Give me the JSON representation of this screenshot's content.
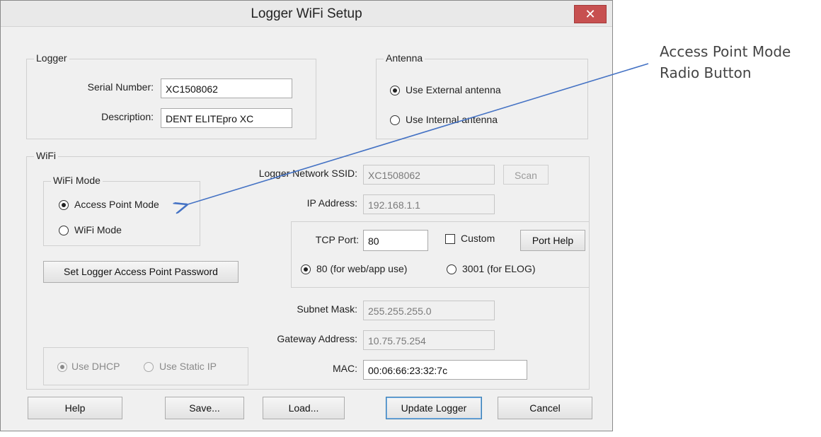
{
  "window": {
    "title": "Logger WiFi Setup",
    "close_glyph": "✕"
  },
  "logger": {
    "group_label": "Logger",
    "serial_label": "Serial Number:",
    "serial_value": "XC1508062",
    "desc_label": "Description:",
    "desc_value": "DENT ELITEpro XC"
  },
  "antenna": {
    "group_label": "Antenna",
    "external_label": "Use External antenna",
    "internal_label": "Use Internal antenna",
    "selected": "external"
  },
  "wifi": {
    "group_label": "WiFi",
    "mode_group_label": "WiFi Mode",
    "ap_mode_label": "Access Point Mode",
    "wifi_mode_label": "WiFi Mode",
    "selected_mode": "access-point",
    "set_password_label": "Set Logger Access Point Password",
    "ssid_label": "Logger Network SSID:",
    "ssid_value": "XC1508062",
    "scan_label": "Scan",
    "ip_label": "IP Address:",
    "ip_value": "192.168.1.1",
    "tcp_port_label": "TCP Port:",
    "tcp_port_value": "80",
    "custom_label": "Custom",
    "port_help_label": "Port Help",
    "port80_label": "80 (for web/app use)",
    "port3001_label": "3001 (for ELOG)",
    "subnet_label": "Subnet Mask:",
    "subnet_value": "255.255.255.0",
    "gateway_label": "Gateway Address:",
    "gateway_value": "10.75.75.254",
    "mac_label": "MAC:",
    "mac_value": "00:06:66:23:32:7c",
    "dhcp_label": "Use DHCP",
    "static_label": "Use Static IP"
  },
  "buttons": {
    "help": "Help",
    "save": "Save...",
    "load": "Load...",
    "update": "Update Logger",
    "cancel": "Cancel"
  },
  "annotation": {
    "line1": "Access Point Mode",
    "line2": "Radio Button",
    "color": "#4472c4"
  }
}
